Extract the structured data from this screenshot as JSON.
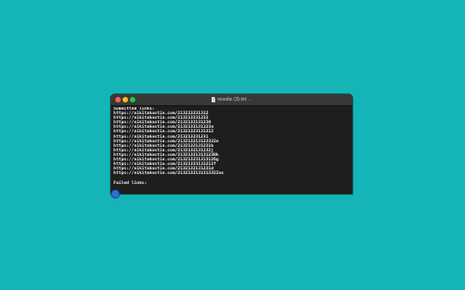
{
  "window": {
    "title": "results (3).txt",
    "title_chevron": "⌄",
    "traffic_lights": {
      "close_color": "#ff5f57",
      "minimize_color": "#febc2e",
      "maximize_color": "#28c840"
    }
  },
  "file": {
    "submitted_header": "Submitted links:",
    "submitted_links": [
      "https://nikitakostin.com/213213231312",
      "https://nikitakostin.com/213213231232",
      "https://nikitakostin.com/2132132131230",
      "https://nikitakostin.com/2132132131123a",
      "https://nikitakostin.com/21321323131312",
      "https://nikitakostin.com/213213231231",
      "https://nikitakostin.com/213213213123322e",
      "https://nikitakostin.com/2132132131231b",
      "https://nikitakostin.com/2132132131232j",
      "https://nikitakostin.com/213213213131230h",
      "https://nikitakostin.com/213213231313126g",
      "https://nikitakostin.com/21321323131212f",
      "https://nikitakostin.com/2132132131231d",
      "https://nikitakostin.com/2132132131313322as"
    ],
    "failed_header": "Failed links:"
  },
  "colors": {
    "desktop_background": "#15b4b6",
    "terminal_background": "#1e1e1e",
    "text": "#f2f2f2",
    "fab": "#2b6fd9"
  }
}
